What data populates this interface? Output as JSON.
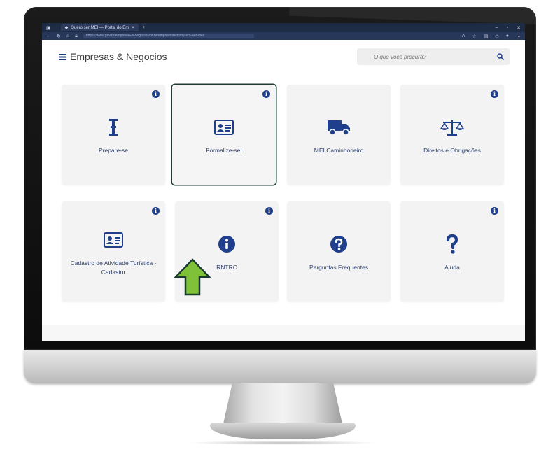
{
  "browser": {
    "tab_title": "Quero ser MEI — Portal do Em",
    "new_tab": "+",
    "url": "https://www.gov.br/empresas-e-negocios/pt-br/empreendedor/quero-ser-mei",
    "window_controls": [
      "–",
      "▫",
      "✕"
    ]
  },
  "header": {
    "title": "Empresas & Negocios",
    "search_placeholder": "O que você procura?"
  },
  "cards": [
    {
      "label": "Prepare-se",
      "icon": "cursor-text-icon"
    },
    {
      "label": "Formalize-se!",
      "icon": "id-card-icon",
      "selected": true
    },
    {
      "label": "MEI Caminhoneiro",
      "icon": "truck-icon"
    },
    {
      "label": "Direitos e Obrigações",
      "icon": "scale-icon"
    },
    {
      "label": "Cadastro de Atividade Turística - Cadastur",
      "icon": "id-card-icon"
    },
    {
      "label": "RNTRC",
      "icon": "info-circle-icon"
    },
    {
      "label": "Perguntas Frequentes",
      "icon": "question-circle-icon"
    },
    {
      "label": "Ajuda",
      "icon": "question-mark-icon"
    }
  ],
  "info_badge": "i",
  "colors": {
    "brand_blue": "#1f3f8c",
    "highlight_arrow": "#7fc23a",
    "selected_outline": "#1b3d35"
  }
}
